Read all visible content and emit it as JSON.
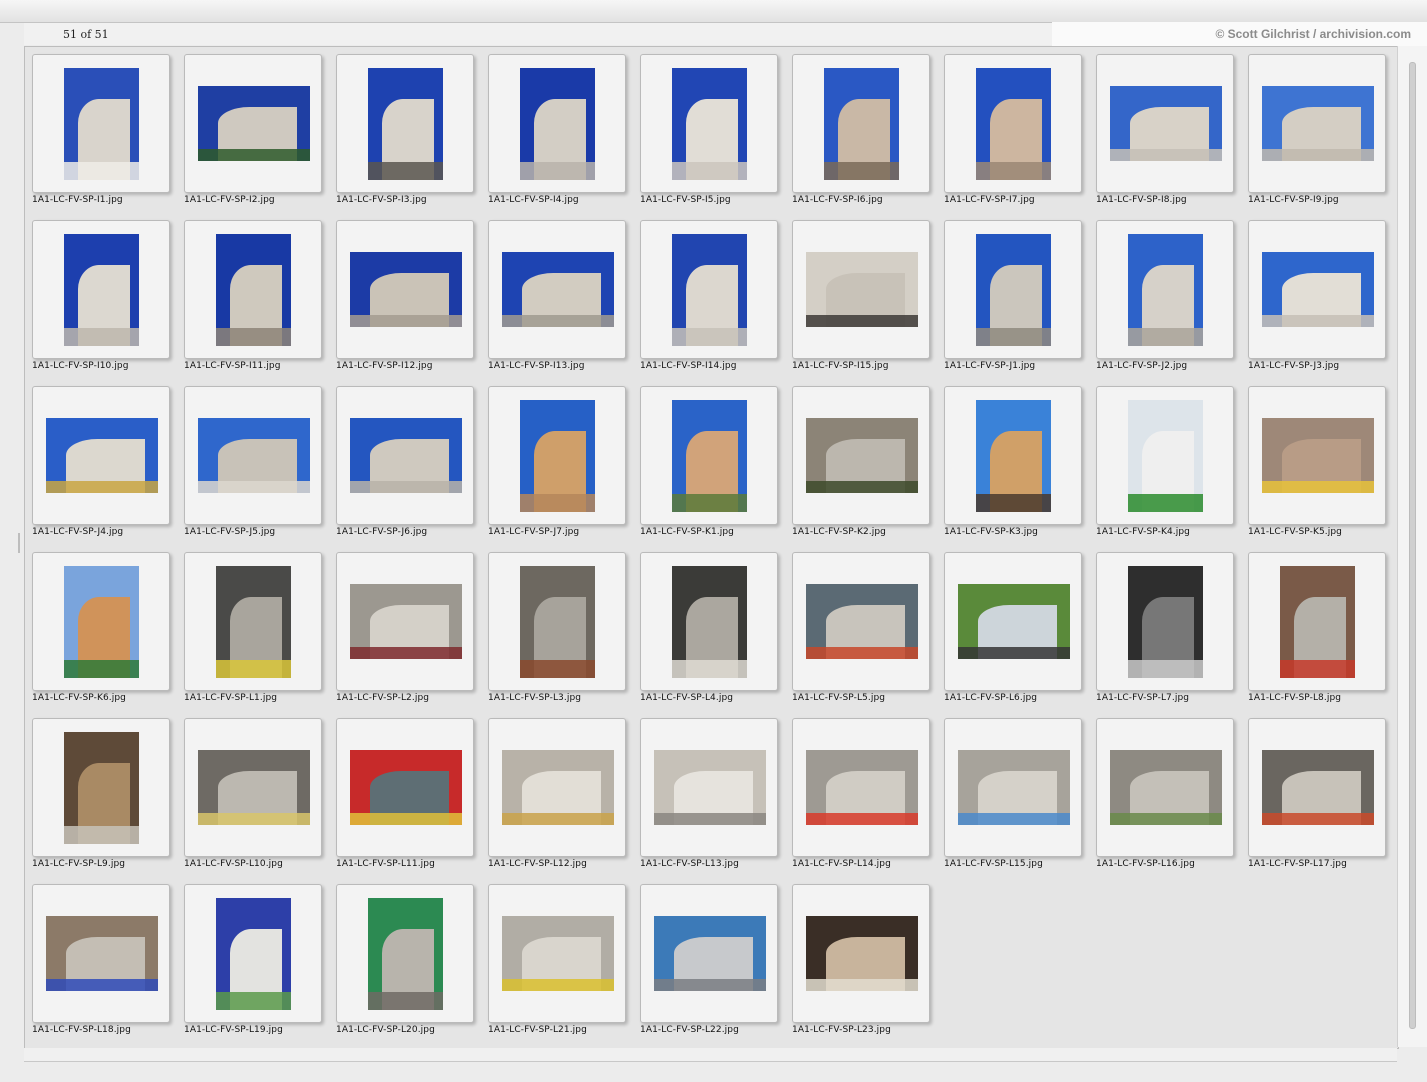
{
  "header": {
    "count": "51 of 51",
    "credit": "© Scott Gilchrist / archivision.com"
  },
  "files": [
    "1A1-LC-FV-SP-I1.jpg",
    "1A1-LC-FV-SP-I2.jpg",
    "1A1-LC-FV-SP-I3.jpg",
    "1A1-LC-FV-SP-I4.jpg",
    "1A1-LC-FV-SP-I5.jpg",
    "1A1-LC-FV-SP-I6.jpg",
    "1A1-LC-FV-SP-I7.jpg",
    "1A1-LC-FV-SP-I8.jpg",
    "1A1-LC-FV-SP-I9.jpg",
    "1A1-LC-FV-SP-I10.jpg",
    "1A1-LC-FV-SP-I11.jpg",
    "1A1-LC-FV-SP-I12.jpg",
    "1A1-LC-FV-SP-I13.jpg",
    "1A1-LC-FV-SP-I14.jpg",
    "1A1-LC-FV-SP-I15.jpg",
    "1A1-LC-FV-SP-J1.jpg",
    "1A1-LC-FV-SP-J2.jpg",
    "1A1-LC-FV-SP-J3.jpg",
    "1A1-LC-FV-SP-J4.jpg",
    "1A1-LC-FV-SP-J5.jpg",
    "1A1-LC-FV-SP-J6.jpg",
    "1A1-LC-FV-SP-J7.jpg",
    "1A1-LC-FV-SP-K1.jpg",
    "1A1-LC-FV-SP-K2.jpg",
    "1A1-LC-FV-SP-K3.jpg",
    "1A1-LC-FV-SP-K4.jpg",
    "1A1-LC-FV-SP-K5.jpg",
    "1A1-LC-FV-SP-K6.jpg",
    "1A1-LC-FV-SP-L1.jpg",
    "1A1-LC-FV-SP-L2.jpg",
    "1A1-LC-FV-SP-L3.jpg",
    "1A1-LC-FV-SP-L4.jpg",
    "1A1-LC-FV-SP-L5.jpg",
    "1A1-LC-FV-SP-L6.jpg",
    "1A1-LC-FV-SP-L7.jpg",
    "1A1-LC-FV-SP-L8.jpg",
    "1A1-LC-FV-SP-L9.jpg",
    "1A1-LC-FV-SP-L10.jpg",
    "1A1-LC-FV-SP-L11.jpg",
    "1A1-LC-FV-SP-L12.jpg",
    "1A1-LC-FV-SP-L13.jpg",
    "1A1-LC-FV-SP-L14.jpg",
    "1A1-LC-FV-SP-L15.jpg",
    "1A1-LC-FV-SP-L16.jpg",
    "1A1-LC-FV-SP-L17.jpg",
    "1A1-LC-FV-SP-L18.jpg",
    "1A1-LC-FV-SP-L19.jpg",
    "1A1-LC-FV-SP-L20.jpg",
    "1A1-LC-FV-SP-L21.jpg",
    "1A1-LC-FV-SP-L22.jpg",
    "1A1-LC-FV-SP-L23.jpg"
  ],
  "orientations": [
    "p",
    "l",
    "p",
    "p",
    "p",
    "p",
    "p",
    "l",
    "l",
    "p",
    "p",
    "l",
    "l",
    "p",
    "l",
    "p",
    "p",
    "l",
    "l",
    "l",
    "l",
    "p",
    "p",
    "l",
    "p",
    "p",
    "l",
    "p",
    "p",
    "l",
    "p",
    "p",
    "l",
    "l",
    "p",
    "p",
    "p",
    "l",
    "l",
    "l",
    "l",
    "l",
    "l",
    "l",
    "l",
    "l",
    "p",
    "p",
    "l",
    "l",
    "l"
  ],
  "palettes": [
    [
      "#2a4fb8",
      "#d9d4cc",
      "#efece6"
    ],
    [
      "#1f3fa3",
      "#cfc9c0",
      "#2e5b2a"
    ],
    [
      "#1e42b0",
      "#d8d3cb",
      "#5a5650"
    ],
    [
      "#1a3aa8",
      "#d3cec5",
      "#b9b3aa"
    ],
    [
      "#2146b4",
      "#e1ddd6",
      "#cbc6bd"
    ],
    [
      "#2a58c4",
      "#c9b8a6",
      "#7a6a58"
    ],
    [
      "#2350bf",
      "#cdb6a0",
      "#9a8774"
    ],
    [
      "#3466c9",
      "#d8d2c8",
      "#c6c0b6"
    ],
    [
      "#3e74d2",
      "#d4cec4",
      "#bfb9ae"
    ],
    [
      "#1d3fae",
      "#dcd8d0",
      "#bdb7ad"
    ],
    [
      "#1839a4",
      "#cfc9be",
      "#8d8478"
    ],
    [
      "#1c3ba6",
      "#cac3b7",
      "#a49c90"
    ],
    [
      "#1e44b2",
      "#d2ccc1",
      "#a09a8f"
    ],
    [
      "#2145b0",
      "#dcd7cf",
      "#c7c2b8"
    ],
    [
      "#d4cfc6",
      "#c8c2b8",
      "#3d3a36"
    ],
    [
      "#2355c0",
      "#cbc6bd",
      "#8f897f"
    ],
    [
      "#2d62c9",
      "#d6d1c9",
      "#aaa49a"
    ],
    [
      "#2e66cc",
      "#e2ded6",
      "#c6c0b6"
    ],
    [
      "#2a5ec8",
      "#dcd8cf",
      "#c9a642"
    ],
    [
      "#2f67cc",
      "#c8c2b8",
      "#dcd7ce"
    ],
    [
      "#2456c0",
      "#cfc9bf",
      "#b9b3a8"
    ],
    [
      "#2660c6",
      "#cf9f6a",
      "#b5865a"
    ],
    [
      "#2a63c8",
      "#d1a37a",
      "#5a7a3a"
    ],
    [
      "#8c8477",
      "#bcb7ae",
      "#3d4a2a"
    ],
    [
      "#3a82d8",
      "#d0a068",
      "#4a3a2e"
    ],
    [
      "#dde4ea",
      "#efefef",
      "#2b8c2e"
    ],
    [
      "#9e8878",
      "#b89c86",
      "#e6c23a"
    ],
    [
      "#7aa4dc",
      "#d0935a",
      "#2f7a38"
    ],
    [
      "#4a4a48",
      "#a9a59d",
      "#d9c63a"
    ],
    [
      "#9c9890",
      "#d4d0c8",
      "#7e2a2e"
    ],
    [
      "#6d6860",
      "#a7a39b",
      "#8a4a2e"
    ],
    [
      "#3b3b38",
      "#aba79f",
      "#dedad2"
    ],
    [
      "#5b6a74",
      "#c8c4bc",
      "#c7482a"
    ],
    [
      "#5a8a3a",
      "#cdd5da",
      "#353535"
    ],
    [
      "#2e2e2e",
      "#777777",
      "#c9c9c9"
    ],
    [
      "#7a5a48",
      "#b4b0a8",
      "#c63a2a"
    ],
    [
      "#5e4a38",
      "#a98a64",
      "#c7c2b9"
    ],
    [
      "#6e6a64",
      "#bcb8b0",
      "#d8c46a"
    ],
    [
      "#c72a2a",
      "#5e6e74",
      "#e0c03a"
    ],
    [
      "#b8b2a8",
      "#e2ded6",
      "#c9a24a"
    ],
    [
      "#c6c1b8",
      "#e6e3dd",
      "#8a8680"
    ],
    [
      "#9e9a93",
      "#d0ccc4",
      "#d83a2a"
    ],
    [
      "#a7a39b",
      "#d5d1c9",
      "#4a8acb"
    ],
    [
      "#8e8a82",
      "#c4c0b8",
      "#6a8a4a"
    ],
    [
      "#6a6660",
      "#c7c2b9",
      "#c94a2a"
    ],
    [
      "#8c7a68",
      "#c4beb4",
      "#2f4bb8"
    ],
    [
      "#2d3fa8",
      "#e3e3e0",
      "#5a9a4a"
    ],
    [
      "#2c8a52",
      "#b8b4ac",
      "#6e6a64"
    ],
    [
      "#b1ada5",
      "#d9d5cd",
      "#d9c02e"
    ],
    [
      "#3c7ab8",
      "#c7c9cc",
      "#7a7e82"
    ],
    [
      "#3a2e26",
      "#c8b49c",
      "#e2dccf"
    ]
  ]
}
